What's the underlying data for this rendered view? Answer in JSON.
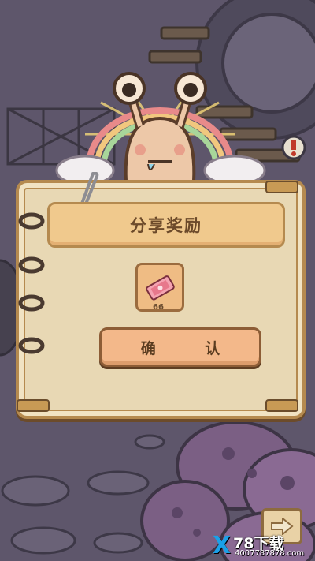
{
  "popup": {
    "title": "分享奖励",
    "reward": {
      "icon": "ticket-icon",
      "count": "66"
    },
    "confirm_label": "确 认"
  },
  "next_icon": "arrow-right-icon",
  "watermark": {
    "main": "78下载",
    "sub": "4007787878.com",
    "mark": "X"
  },
  "colors": {
    "background": "#5b5467",
    "panel": "#e8d8b4",
    "button": "#f3b88a",
    "border": "#b58a4f"
  }
}
